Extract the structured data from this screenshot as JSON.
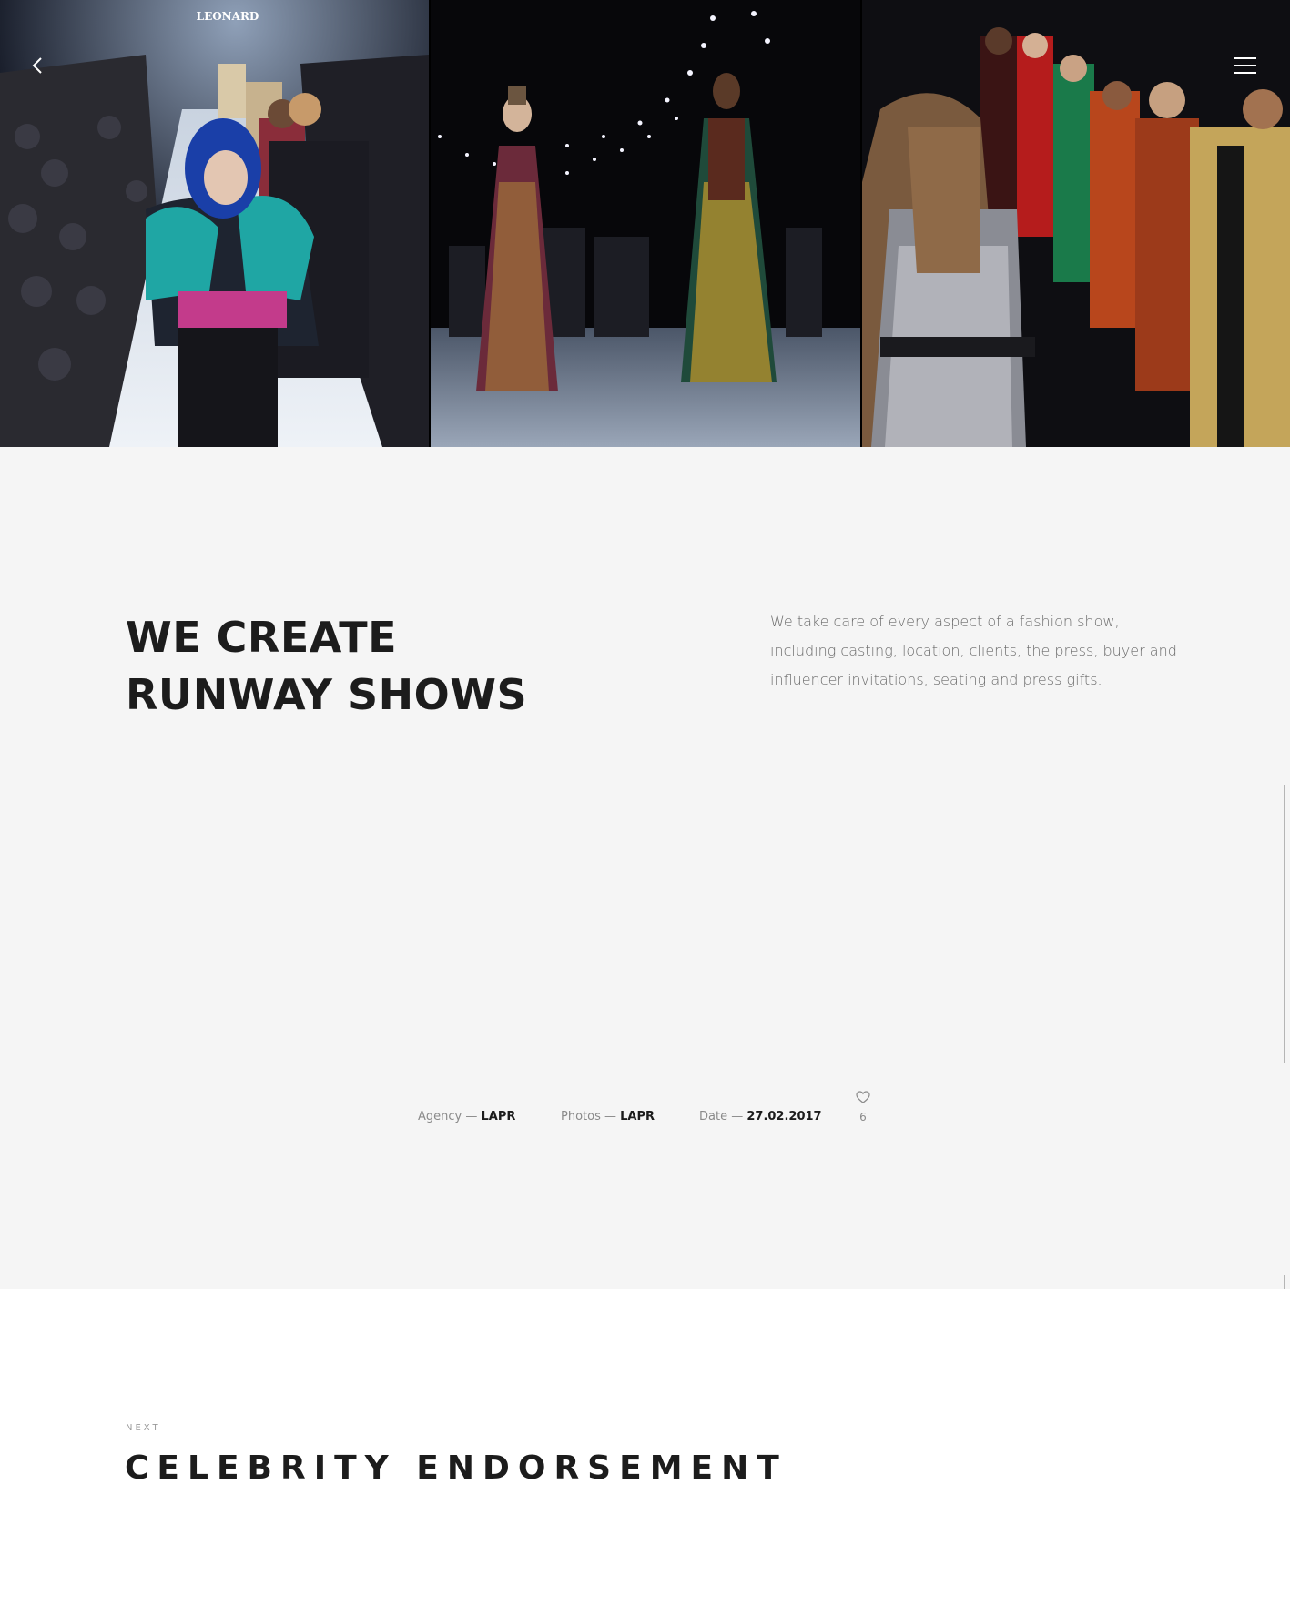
{
  "nav": {
    "back_icon": "chevron-left-icon",
    "menu_icon": "hamburger-menu-icon"
  },
  "gallery": {
    "images": [
      {
        "name": "runway-photo-1"
      },
      {
        "name": "runway-photo-2"
      },
      {
        "name": "runway-photo-3"
      }
    ],
    "logo_text": "LEONARD"
  },
  "intro": {
    "headline_line1": "WE CREATE",
    "headline_line2": "RUNWAY SHOWS",
    "description": "We take care of every aspect of a fashion show, including casting, location, clients, the press, buyer and influencer invitations, seating and press gifts."
  },
  "meta": {
    "agency_label": "Agency —",
    "agency_value": "LAPR",
    "photos_label": "Photos —",
    "photos_value": "LAPR",
    "date_label": "Date —",
    "date_value": "27.02.2017",
    "like_icon": "heart-icon",
    "like_count": "6"
  },
  "next": {
    "label": "NEXT",
    "title": "CELEBRITY ENDORSEMENT"
  },
  "colors": {
    "intro_bg": "#f5f5f5",
    "text_dark": "#1c1c1c",
    "text_muted": "#6b6b6b"
  }
}
